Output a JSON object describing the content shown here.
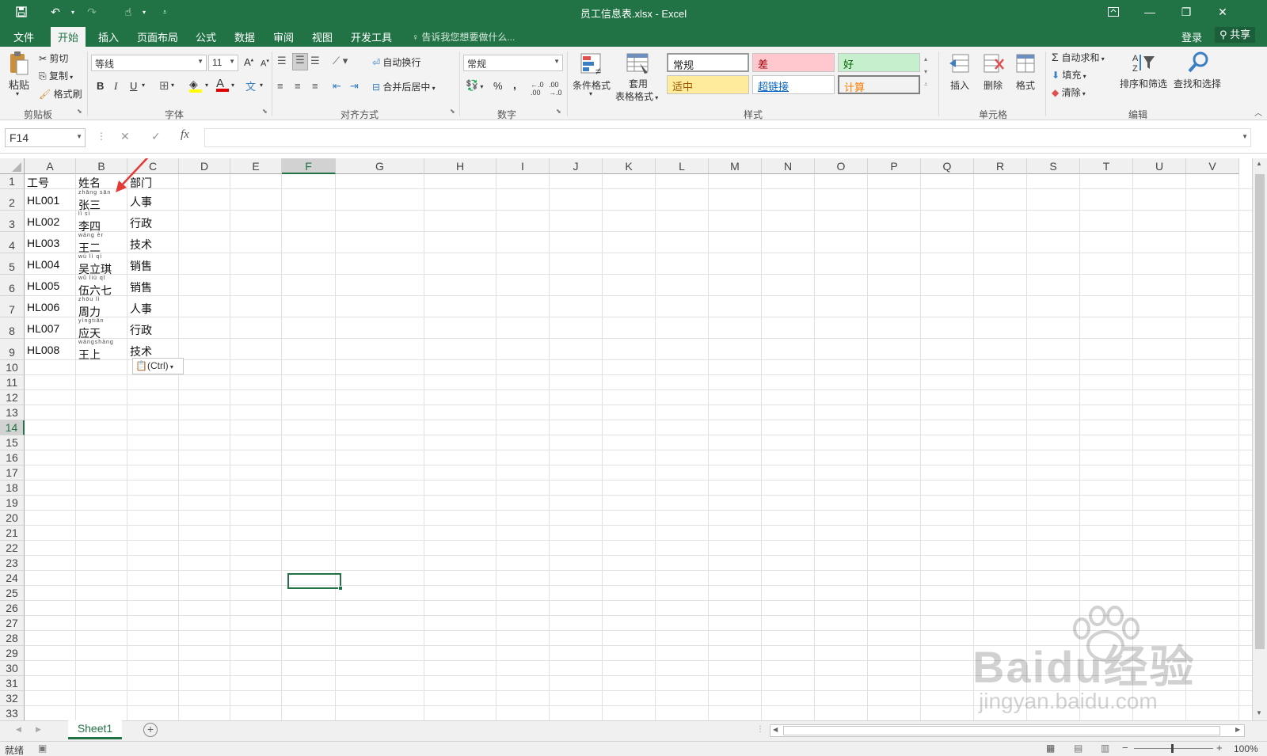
{
  "window": {
    "title": "员工信息表.xlsx - Excel"
  },
  "tabs": [
    "文件",
    "开始",
    "插入",
    "页面布局",
    "公式",
    "数据",
    "审阅",
    "视图",
    "开发工具"
  ],
  "tell_me": "告诉我您想要做什么...",
  "account": {
    "login": "登录",
    "share": "共享"
  },
  "clipboard": {
    "paste": "粘贴",
    "cut": "剪切",
    "copy": "复制",
    "format_painter": "格式刷",
    "label": "剪贴板"
  },
  "font": {
    "name": "等线",
    "size": "11",
    "bold": "B",
    "italic": "I",
    "underline": "U",
    "font_color_glyph": "A",
    "grow": "A",
    "shrink": "A",
    "label": "字体"
  },
  "alignment": {
    "wrap": "自动换行",
    "merge": "合并后居中",
    "label": "对齐方式"
  },
  "number": {
    "format": "常规",
    "percent": "%",
    "comma": ",",
    "label": "数字"
  },
  "styles": {
    "conditional": "条件格式",
    "table_line1": "套用",
    "table_line2": "表格格式",
    "label": "样式",
    "boxes": [
      {
        "text": "常规",
        "bg": "#ffffff",
        "color": "#222222"
      },
      {
        "text": "差",
        "bg": "#ffc7ce",
        "color": "#9c0006"
      },
      {
        "text": "好",
        "bg": "#c6efce",
        "color": "#006100"
      },
      {
        "text": "适中",
        "bg": "#ffeb9c",
        "color": "#9c5700"
      },
      {
        "text": "超链接",
        "bg": "#ffffff",
        "color": "#0563c1"
      },
      {
        "text": "计算",
        "bg": "#f2f2f2",
        "color": "#fa7d00"
      }
    ]
  },
  "cells_group": {
    "insert": "插入",
    "delete": "删除",
    "format": "格式",
    "label": "单元格"
  },
  "editing": {
    "autosum": "自动求和",
    "fill": "填充",
    "clear": "清除",
    "sort": "排序和筛选",
    "find": "查找和选择",
    "label": "编辑"
  },
  "formula_bar": {
    "name_box": "F14",
    "fx": "fx",
    "value": ""
  },
  "columns": [
    "A",
    "B",
    "C",
    "D",
    "E",
    "F",
    "G",
    "H",
    "I",
    "J",
    "K",
    "L",
    "M",
    "N",
    "O",
    "P",
    "Q",
    "R",
    "S",
    "T",
    "U",
    "V"
  ],
  "selected_column": "F",
  "rows": [
    "1",
    "2",
    "3",
    "4",
    "5",
    "6",
    "7",
    "8",
    "9",
    "10",
    "11",
    "12",
    "13",
    "14",
    "15",
    "16",
    "17",
    "18",
    "19",
    "20",
    "21",
    "22",
    "23",
    "24",
    "25",
    "26",
    "27",
    "28",
    "29",
    "30",
    "31",
    "32",
    "33"
  ],
  "selected_row": "14",
  "table": {
    "header": [
      "工号",
      "姓名",
      "部门"
    ],
    "records": [
      {
        "id": "HL001",
        "name": "张三",
        "pinyin": "zhāng sān",
        "dept": "人事"
      },
      {
        "id": "HL002",
        "name": "李四",
        "pinyin": "lǐ sì",
        "dept": "行政"
      },
      {
        "id": "HL003",
        "name": "王二",
        "pinyin": "wáng èr",
        "dept": "技术"
      },
      {
        "id": "HL004",
        "name": "吴立琪",
        "pinyin": "wú lì qí",
        "dept": "销售"
      },
      {
        "id": "HL005",
        "name": "伍六七",
        "pinyin": "wǔ liù qī",
        "dept": "销售"
      },
      {
        "id": "HL006",
        "name": "周力",
        "pinyin": "zhōu lì",
        "dept": "人事"
      },
      {
        "id": "HL007",
        "name": "应天",
        "pinyin": "yìngtiān",
        "dept": "行政"
      },
      {
        "id": "HL008",
        "name": "王上",
        "pinyin": "wángshàng",
        "dept": "技术"
      }
    ]
  },
  "paste_options": "(Ctrl)",
  "sheet_tabs": [
    "Sheet1"
  ],
  "status": {
    "ready": "就绪",
    "zoom": "100%"
  },
  "watermark": {
    "brand": "Baidu经验",
    "url": "jingyan.baidu.com"
  },
  "colors": {
    "excel_green": "#217346",
    "annotation_arrow": "#e53935"
  }
}
